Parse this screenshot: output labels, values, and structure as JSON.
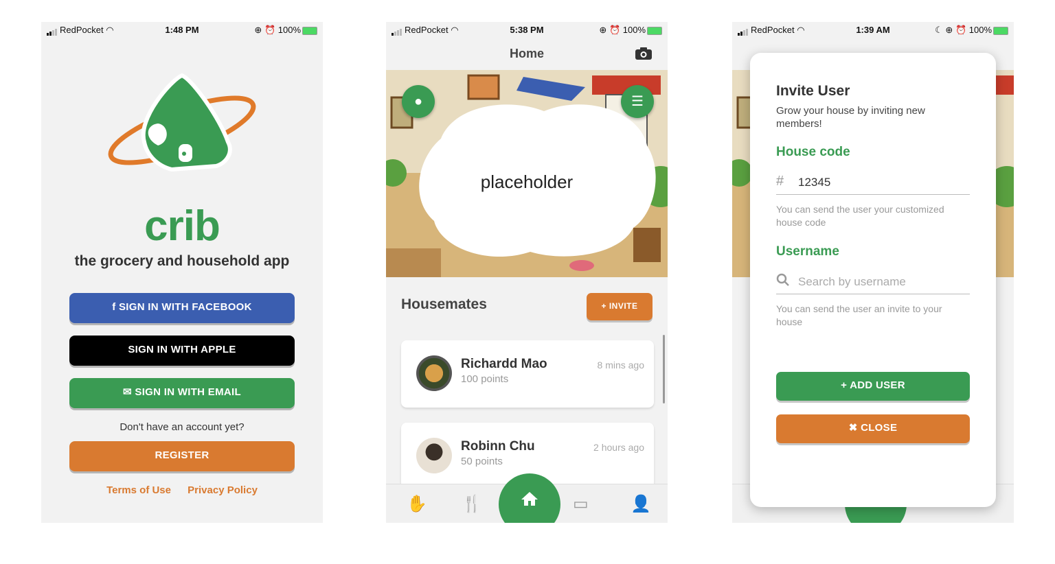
{
  "status_bars": [
    {
      "carrier": "RedPocket",
      "time": "1:48 PM",
      "battery": "100%"
    },
    {
      "carrier": "RedPocket",
      "time": "5:38 PM",
      "battery": "100%"
    },
    {
      "carrier": "RedPocket",
      "time": "1:39 AM",
      "battery": "100%"
    }
  ],
  "login": {
    "brand": "crib",
    "tagline": "the grocery and household app",
    "facebook_label": "SIGN IN WITH FACEBOOK",
    "apple_label": "SIGN IN WITH APPLE",
    "email_label": "SIGN IN WITH EMAIL",
    "no_account": "Don't have an account yet?",
    "register_label": "REGISTER",
    "terms_label": "Terms of Use",
    "privacy_label": "Privacy Policy",
    "colors": {
      "green": "#3a9b53",
      "orange": "#d97a30",
      "facebook": "#3b5eb0"
    }
  },
  "home": {
    "title": "Home",
    "placeholder": "placeholder",
    "section_title": "Housemates",
    "invite_label": "+ INVITE",
    "housemates": [
      {
        "name": "Richardd Mao",
        "points": "100 points",
        "ago": "8 mins ago"
      },
      {
        "name": "Robinn Chu",
        "points": "50 points",
        "ago": "2 hours ago"
      }
    ],
    "tabs": [
      "hand-icon",
      "utensils-icon",
      "home-icon",
      "money-icon",
      "user-icon"
    ]
  },
  "invite_modal": {
    "title": "Invite User",
    "subtitle": "Grow your house by inviting new members!",
    "house_code_label": "House code",
    "house_code_value": "12345",
    "house_code_help": "You can send the user your customized house code",
    "username_label": "Username",
    "username_placeholder": "Search by username",
    "username_help": "You can send the user an invite to your house",
    "add_label": "ADD USER",
    "close_label": "CLOSE"
  }
}
